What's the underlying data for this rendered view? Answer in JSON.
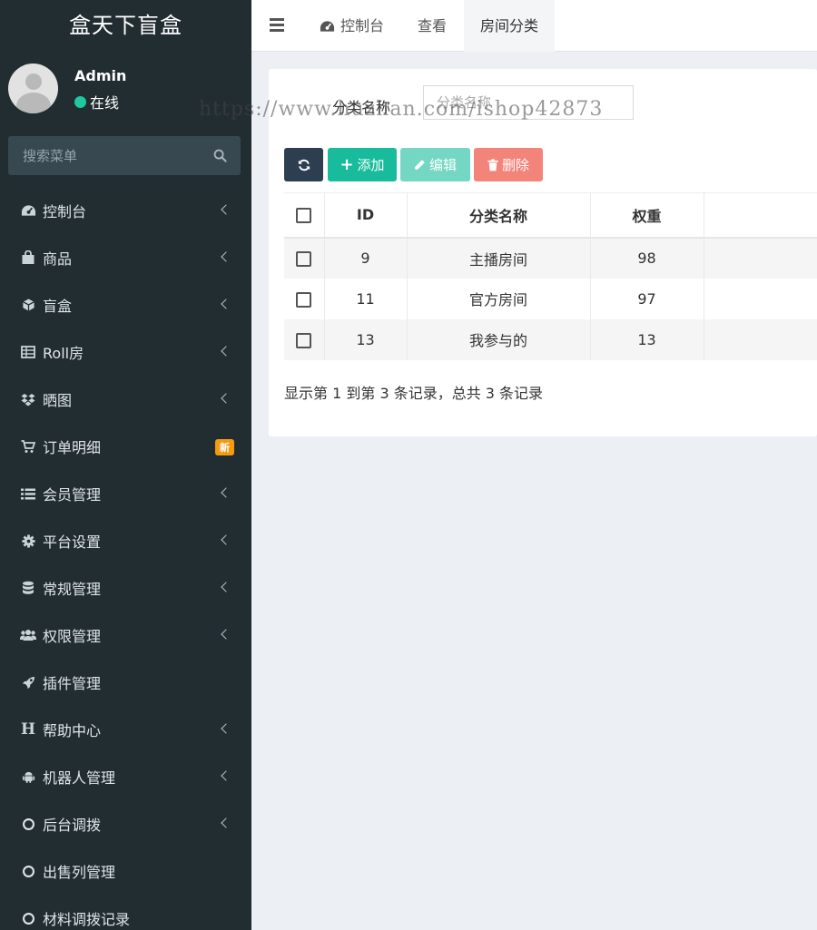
{
  "app": {
    "title": "盒天下盲盒"
  },
  "user": {
    "name": "Admin",
    "status": "在线"
  },
  "search": {
    "placeholder": "搜索菜单"
  },
  "sidebar": {
    "items": [
      {
        "label": "控制台",
        "icon": "dashboard-icon"
      },
      {
        "label": "商品",
        "icon": "shopping-bag-icon"
      },
      {
        "label": "盲盒",
        "icon": "cube-icon"
      },
      {
        "label": "Roll房",
        "icon": "table-icon"
      },
      {
        "label": "晒图",
        "icon": "dropbox-icon"
      },
      {
        "label": "订单明细",
        "icon": "cart-icon",
        "badge": "新"
      },
      {
        "label": "会员管理",
        "icon": "list-icon"
      },
      {
        "label": "平台设置",
        "icon": "gear-icon"
      },
      {
        "label": "常规管理",
        "icon": "database-icon"
      },
      {
        "label": "权限管理",
        "icon": "users-icon"
      },
      {
        "label": "插件管理",
        "icon": "rocket-icon"
      },
      {
        "label": "帮助中心",
        "icon": "header-icon"
      },
      {
        "label": "机器人管理",
        "icon": "android-icon"
      },
      {
        "label": "后台调拨",
        "icon": "circle-icon"
      },
      {
        "label": "出售列管理",
        "icon": "circle-icon"
      },
      {
        "label": "材料调拨记录",
        "icon": "circle-icon"
      }
    ]
  },
  "header": {
    "tabs": [
      {
        "label": "控制台"
      },
      {
        "label": "查看"
      },
      {
        "label": "房间分类"
      }
    ]
  },
  "filter": {
    "label": "分类名称",
    "placeholder": "分类名称"
  },
  "toolbar": {
    "add_label": "添加",
    "edit_label": "编辑",
    "delete_label": "删除"
  },
  "table": {
    "headers": {
      "id": "ID",
      "name": "分类名称",
      "weight": "权重"
    },
    "rows": [
      {
        "id": "9",
        "name": "主播房间",
        "weight": "98"
      },
      {
        "id": "11",
        "name": "官方房间",
        "weight": "97"
      },
      {
        "id": "13",
        "name": "我参与的",
        "weight": "13"
      }
    ]
  },
  "pagination": {
    "summary": "显示第 1 到第 3 条记录，总共 3 条记录"
  },
  "watermark": "https://www.huzhan.com/ishop42873",
  "colors": {
    "sidebar_bg": "#222d32",
    "primary": "#2c3e50",
    "success": "#18bc9c",
    "danger": "#f2847a",
    "badge": "#f39c12",
    "online": "#1fc8a1"
  }
}
